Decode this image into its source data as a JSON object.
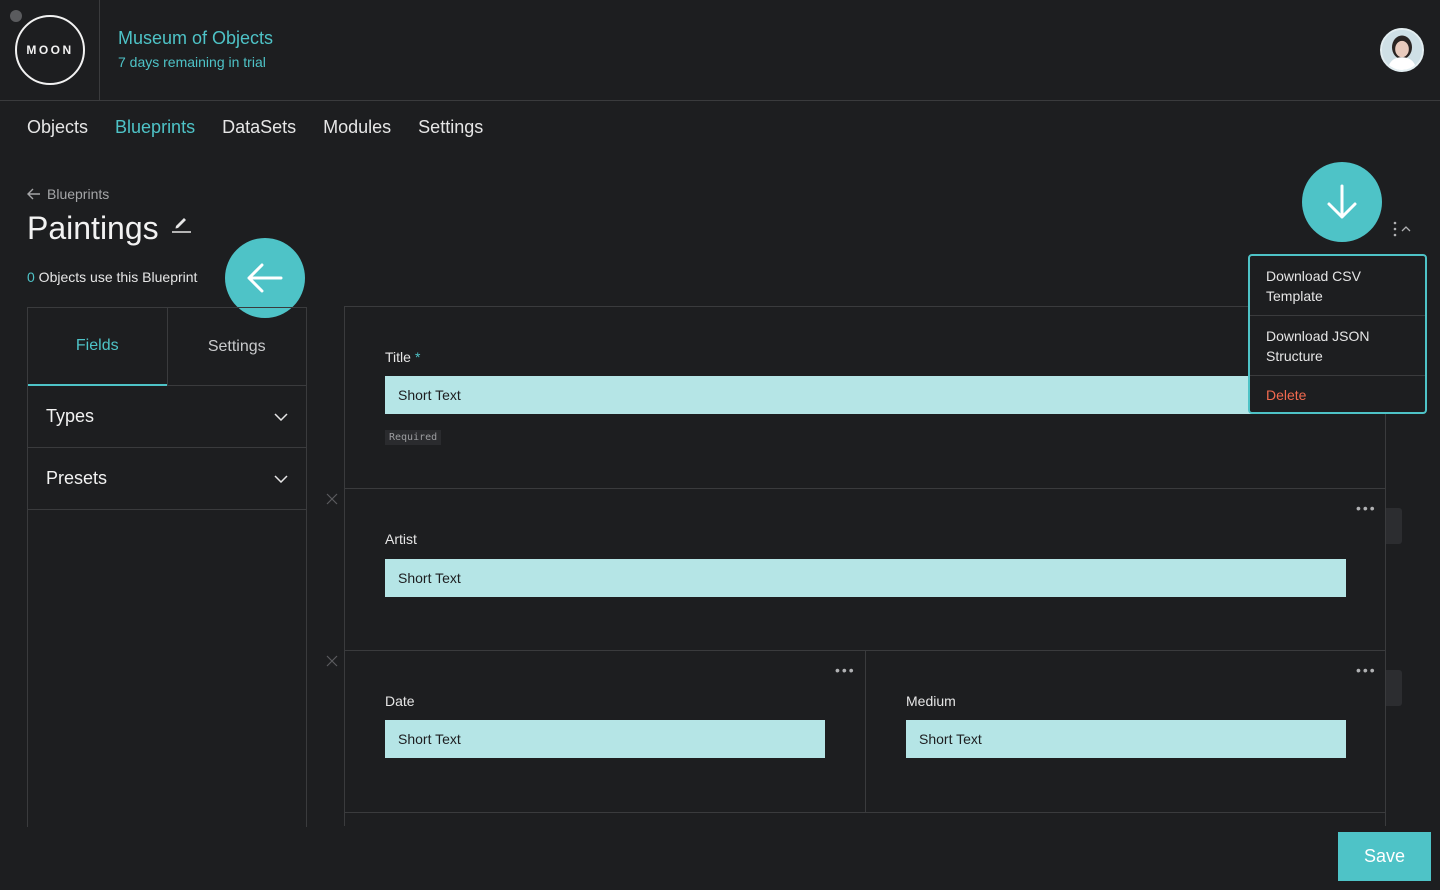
{
  "header": {
    "logo_text": "MOON",
    "org_name": "Museum of Objects",
    "trial_status": "7 days remaining in trial"
  },
  "nav": {
    "items": [
      "Objects",
      "Blueprints",
      "DataSets",
      "Modules",
      "Settings"
    ],
    "active": "Blueprints"
  },
  "breadcrumb": {
    "label": "Blueprints"
  },
  "page": {
    "title": "Paintings",
    "usage_count": "0",
    "usage_text": " Objects use this Blueprint"
  },
  "sidebar": {
    "tabs": [
      "Fields",
      "Settings"
    ],
    "active_tab": "Fields",
    "sections": [
      "Types",
      "Presets"
    ]
  },
  "fields": [
    {
      "label": "Title",
      "required_mark": "*",
      "type": "Short Text",
      "tag": "Required"
    },
    {
      "label": "Artist",
      "type": "Short Text"
    },
    {
      "label": "Date",
      "type": "Short Text"
    },
    {
      "label": "Medium",
      "type": "Short Text"
    }
  ],
  "menu": {
    "items": [
      "Download CSV Template",
      "Download JSON Structure",
      "Delete"
    ]
  },
  "footer": {
    "save_label": "Save"
  },
  "colors": {
    "accent": "#4ec3c7",
    "input_bg": "#b5e5e6",
    "danger": "#f36a4f",
    "background": "#1d1e20"
  }
}
